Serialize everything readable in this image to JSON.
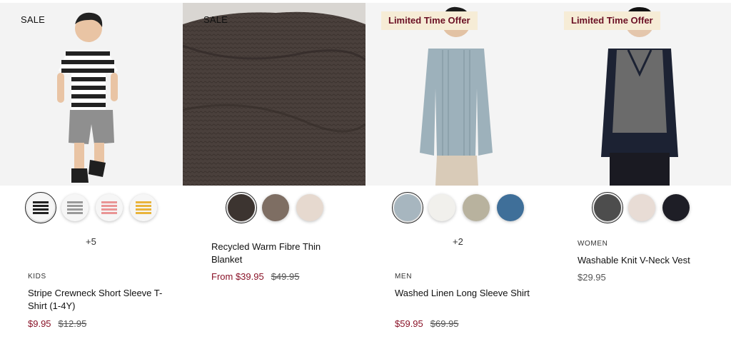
{
  "products": [
    {
      "badge": "SALE",
      "more_colors": "+5",
      "category": "KIDS",
      "name": "Stripe Crewneck Short Sleeve T-Shirt (1-4Y)",
      "price_now": "$9.95",
      "price_was": "$12.95"
    },
    {
      "badge": "SALE",
      "name": "Recycled Warm Fibre Thin Blanket",
      "price_now": "From $39.95",
      "price_was": "$49.95"
    },
    {
      "badge": "Limited Time Offer",
      "more_colors": "+2",
      "category": "MEN",
      "name": "Washed Linen Long Sleeve Shirt",
      "price_now": "$59.95",
      "price_was": "$69.95"
    },
    {
      "badge": "Limited Time Offer",
      "category": "WOMEN",
      "name": "Washable Knit V-Neck Vest",
      "price": "$29.95"
    }
  ],
  "colors": {
    "sale_price": "#8a1328",
    "offer_badge_bg": "#f6ecd6",
    "offer_badge_text": "#6b1024"
  }
}
